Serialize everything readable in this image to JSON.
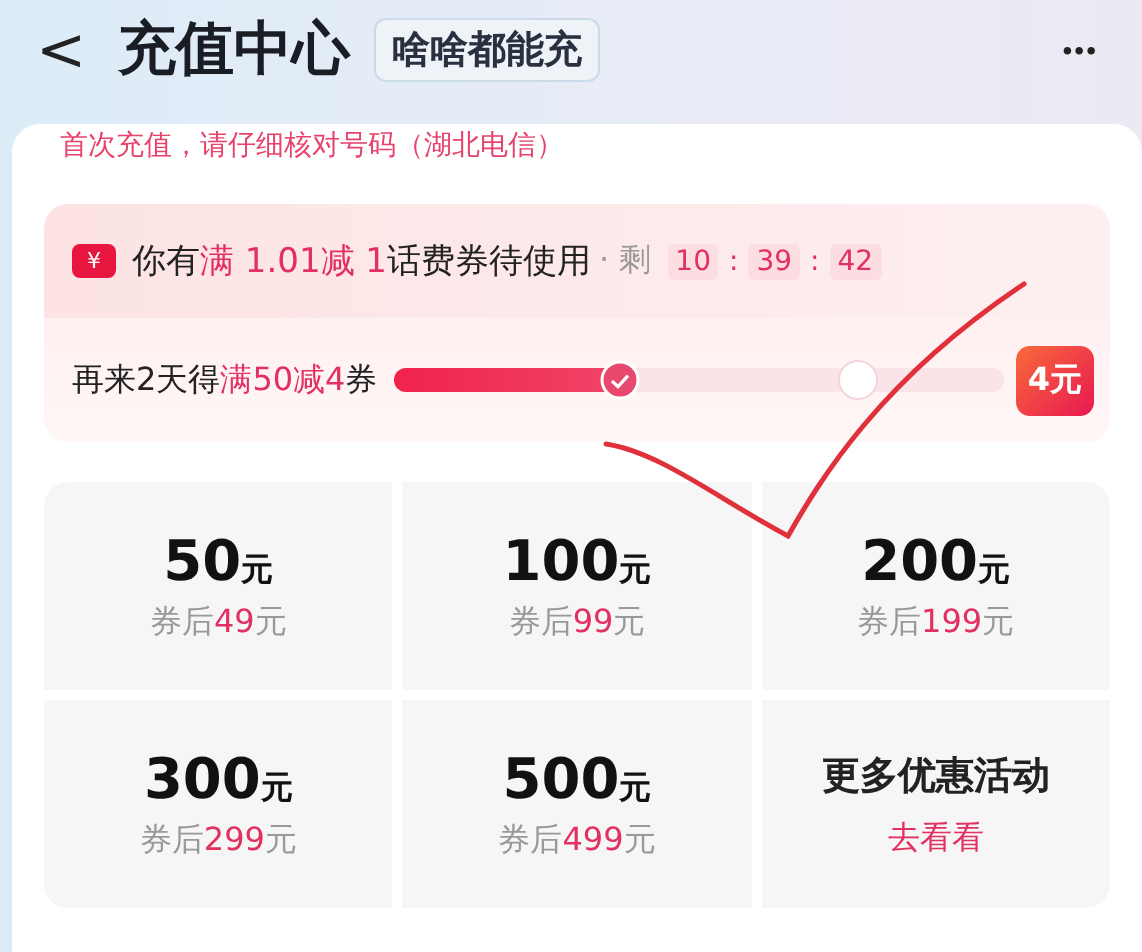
{
  "header": {
    "back": "<",
    "title": "充值中心",
    "badge": "啥啥都能充",
    "more": "•••"
  },
  "notice": "首次充值，请仔细核对号码（湖北电信）",
  "coupon": {
    "icon": "¥",
    "text": "你有**满 1.01减 1**话费券待使用",
    "remain_label": "· 剩",
    "countdown": [
      "10",
      "39",
      "42"
    ],
    "separators": [
      ":",
      ":"
    ],
    "progress": {
      "text": "再来2天得**满50减4**券",
      "level": 0.37,
      "milestones": [
        {
          "level": 0.37,
          "reached": true
        },
        {
          "level": 0.76,
          "reached": false
        }
      ],
      "reward": "4元"
    }
  },
  "tiles": [
    {
      "kind": "price",
      "amount": "50",
      "unit": "元",
      "after": "券后**49**元"
    },
    {
      "kind": "price",
      "amount": "100",
      "unit": "元",
      "after": "券后**99**元"
    },
    {
      "kind": "price",
      "amount": "200",
      "unit": "元",
      "after": "券后**199**元"
    },
    {
      "kind": "price",
      "amount": "300",
      "unit": "元",
      "after": "券后**299**元"
    },
    {
      "kind": "price",
      "amount": "500",
      "unit": "元",
      "after": "券后**499**元"
    },
    {
      "kind": "link",
      "title": "更多优惠活动",
      "action": "去看看"
    }
  ],
  "annotation": {
    "kind": "checkmark"
  }
}
